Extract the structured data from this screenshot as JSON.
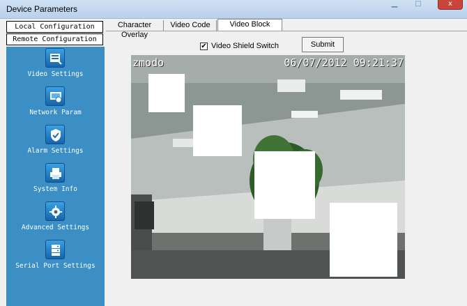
{
  "window": {
    "title": "Device Parameters",
    "close_glyph": "x"
  },
  "config": {
    "local_label": "Local Configuration",
    "remote_label": "Remote Configuration"
  },
  "sidebar": {
    "items": [
      {
        "label": "Video Settings",
        "icon": "video-settings-icon"
      },
      {
        "label": "Network Param",
        "icon": "network-icon"
      },
      {
        "label": "Alarm Settings",
        "icon": "shield-icon"
      },
      {
        "label": "System Info",
        "icon": "printer-icon"
      },
      {
        "label": "Advanced Settings",
        "icon": "gear-icon"
      },
      {
        "label": "Serial Port Settings",
        "icon": "serial-port-icon"
      }
    ],
    "bg_color": "#3b8fc4"
  },
  "tabs": [
    {
      "label": "Character Overlay"
    },
    {
      "label": "Video Code"
    },
    {
      "label": "Video Block",
      "active": true
    }
  ],
  "shield": {
    "label": "Video Shield Switch",
    "checked": true,
    "check_glyph": "✔"
  },
  "submit_label": "Submit",
  "video": {
    "camera_name": "zmodo",
    "timestamp": "06/07/2012 09:21:37"
  }
}
